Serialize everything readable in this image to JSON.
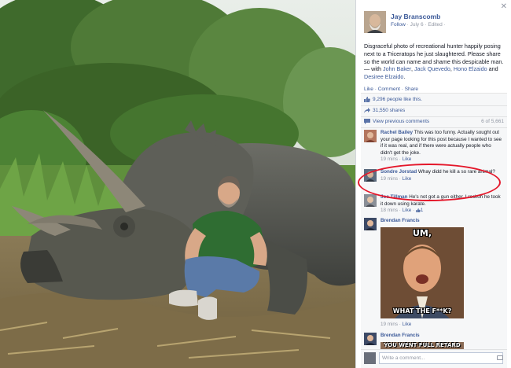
{
  "post": {
    "author": "Jay Branscomb",
    "follow": "Follow",
    "date": "· July 6 · Edited ·",
    "text_1": "Disgraceful photo of recreational hunter happily posing next to a Triceratops he just slaughtered. Please share so the world can name and shame this despicable man. — with ",
    "tag_1": "John Baker",
    "comma_1": ", ",
    "tag_2": "Jack Quevedo",
    "comma_2": ", ",
    "tag_3": "Hono Elzaido",
    "and": " and ",
    "tag_4": "Desiree Elzaido",
    "dot": "."
  },
  "actions": {
    "like": "Like",
    "comment": "Comment",
    "share": "Share",
    "sep": " · "
  },
  "ufi": {
    "likes": "9,296 people like this.",
    "shares": "31,550 shares",
    "view_previous": "View previous comments",
    "count": "6 of 5,661"
  },
  "comments": [
    {
      "author": "Rachel Bailey",
      "text": " This was too funny. Actually sought out your page looking for this post because I wanted to see if it was real, and if there were actually people who didn't get the joke.",
      "time": "19 mins",
      "like": "Like"
    },
    {
      "author": "Sondre Jorstad",
      "text": " Whay didd he kill a so rare animal?",
      "time": "19 mins",
      "like": "Like"
    },
    {
      "author": "Joe Tillman",
      "text": " He's not got a gun either. I reckon he took it down using karate.",
      "time": "18 mins",
      "like": "Like",
      "likes": "1"
    },
    {
      "author": "Brendan Francis",
      "time": "19 mins",
      "like": "Like",
      "meme_top": "UM,",
      "meme_bottom": "WHAT THE F**K?"
    },
    {
      "author": "Brendan Francis",
      "meme_top": "YOU WENT FULL RETARD"
    }
  ],
  "write": {
    "placeholder": "Write a comment..."
  },
  "colors": {
    "link": "#3b5998",
    "annotation": "#e4172a"
  }
}
